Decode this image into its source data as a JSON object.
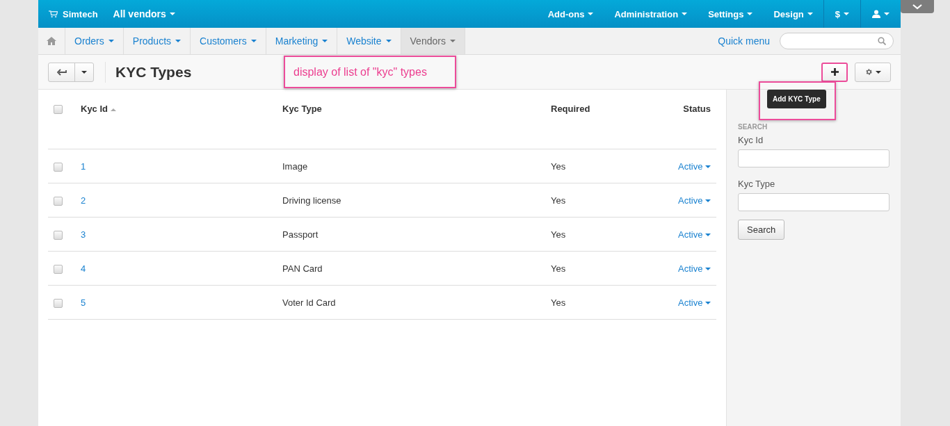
{
  "top_bar": {
    "brand": "Simtech",
    "vendor_menu": "All vendors",
    "menus": [
      "Add-ons",
      "Administration",
      "Settings",
      "Design"
    ],
    "currency": "$"
  },
  "nav": {
    "items": [
      {
        "label": "Orders",
        "selected": false
      },
      {
        "label": "Products",
        "selected": false
      },
      {
        "label": "Customers",
        "selected": false
      },
      {
        "label": "Marketing",
        "selected": false
      },
      {
        "label": "Website",
        "selected": false
      },
      {
        "label": "Vendors",
        "selected": true
      }
    ],
    "quick_menu": "Quick menu"
  },
  "page": {
    "title": "KYC Types",
    "annotation": "display of list of \"kyc\" types",
    "tooltip": "Add KYC Type"
  },
  "table": {
    "select_all_checked": false,
    "columns": [
      "Kyc Id",
      "Kyc Type",
      "Required",
      "Status"
    ],
    "rows": [
      {
        "id": "1",
        "type": "Image",
        "required": "Yes",
        "status": "Active",
        "checked": false
      },
      {
        "id": "2",
        "type": "Driving license",
        "required": "Yes",
        "status": "Active",
        "checked": false
      },
      {
        "id": "3",
        "type": "Passport",
        "required": "Yes",
        "status": "Active",
        "checked": false
      },
      {
        "id": "4",
        "type": "PAN Card",
        "required": "Yes",
        "status": "Active",
        "checked": false
      },
      {
        "id": "5",
        "type": "Voter Id Card",
        "required": "Yes",
        "status": "Active",
        "checked": false
      }
    ]
  },
  "search": {
    "heading": "SEARCH",
    "fields": [
      "Kyc Id",
      "Kyc Type"
    ],
    "button": "Search"
  }
}
